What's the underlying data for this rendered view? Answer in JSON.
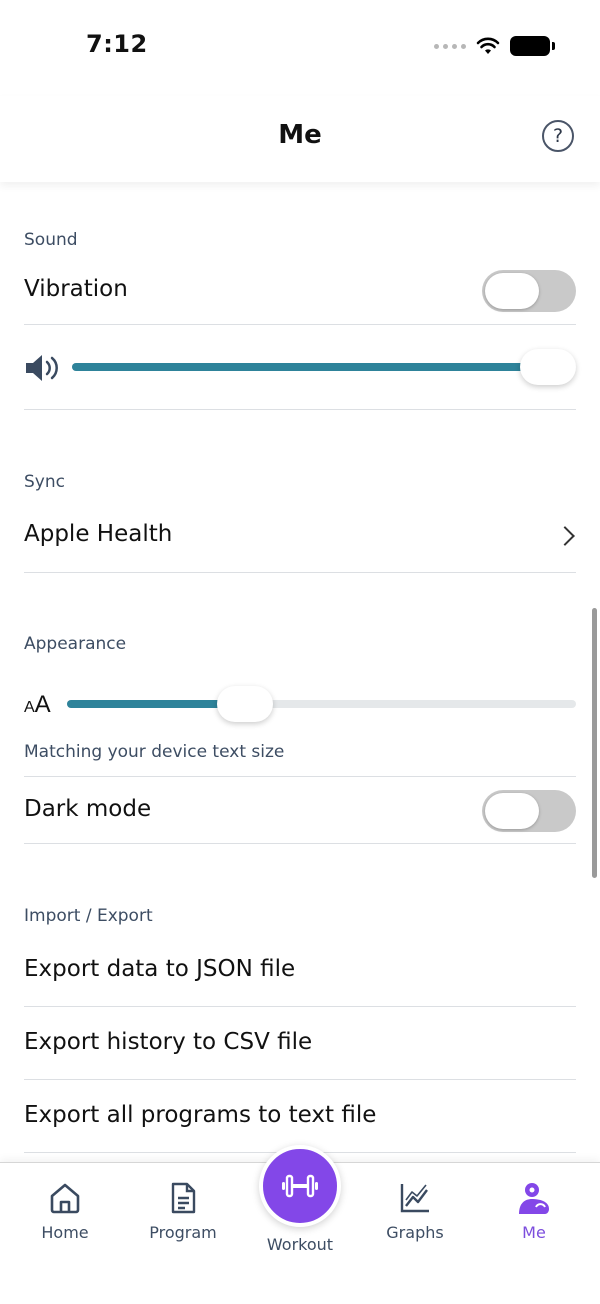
{
  "status": {
    "time": "7:12"
  },
  "header": {
    "title": "Me",
    "help_glyph": "?"
  },
  "sections": {
    "sound": {
      "label": "Sound",
      "vibration_label": "Vibration",
      "vibration_on": false,
      "volume_level": 0.9
    },
    "sync": {
      "label": "Sync",
      "apple_health_label": "Apple Health"
    },
    "appearance": {
      "label": "Appearance",
      "text_size_small": "A",
      "text_size_big": "A",
      "text_size_level": 0.3,
      "text_size_caption": "Matching your device text size",
      "dark_mode_label": "Dark mode",
      "dark_mode_on": false
    },
    "import_export": {
      "label": "Import / Export",
      "items": [
        "Export data to JSON file",
        "Export history to CSV file",
        "Export all programs to text file"
      ]
    }
  },
  "tabs": [
    {
      "label": "Home",
      "icon": "home-icon",
      "active": false
    },
    {
      "label": "Program",
      "icon": "document-icon",
      "active": false
    },
    {
      "label": "Workout",
      "icon": "dumbbell-icon",
      "active": false
    },
    {
      "label": "Graphs",
      "icon": "graph-icon",
      "active": false
    },
    {
      "label": "Me",
      "icon": "profile-icon",
      "active": true
    }
  ],
  "colors": {
    "accent": "#8347e8",
    "slider": "#2e839a",
    "toggle_off": "#c9c9c9"
  }
}
